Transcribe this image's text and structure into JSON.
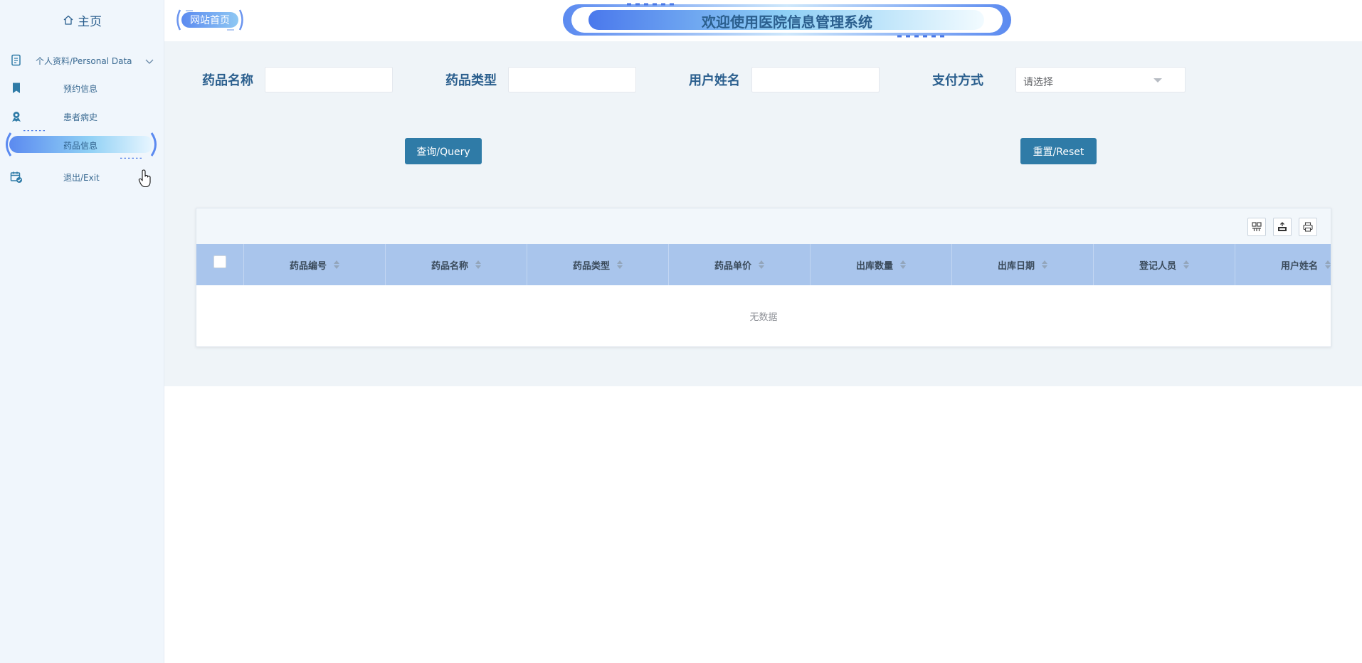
{
  "sidebar": {
    "home_label": "主页",
    "items": [
      {
        "label": "个人资料/Personal Data",
        "icon": "document-icon"
      },
      {
        "label": "预约信息",
        "icon": "bookmark-icon"
      },
      {
        "label": "患者病史",
        "icon": "user-badge-icon"
      },
      {
        "label": "药品信息",
        "icon": "none",
        "active": true
      },
      {
        "label": "退出/Exit",
        "icon": "calendar-check-icon"
      }
    ]
  },
  "header": {
    "home_link": "网站首页",
    "title": "欢迎使用医院信息管理系统"
  },
  "search": {
    "fields": [
      {
        "label": "药品名称",
        "value": "",
        "placeholder": ""
      },
      {
        "label": "药品类型",
        "value": "",
        "placeholder": ""
      },
      {
        "label": "用户姓名",
        "value": "",
        "placeholder": ""
      }
    ],
    "payment": {
      "label": "支付方式",
      "placeholder": "请选择"
    },
    "query_button": "查询/Query",
    "reset_button": "重置/Reset"
  },
  "table": {
    "columns": [
      "药品编号",
      "药品名称",
      "药品类型",
      "药品单价",
      "出库数量",
      "出库日期",
      "登记人员",
      "用户姓名"
    ],
    "empty_text": "无数据",
    "tools": [
      "grid-icon",
      "export-icon",
      "print-icon"
    ]
  },
  "colors": {
    "primary_button": "#2f7ba7",
    "header_row": "#a9c5ec",
    "label_text": "#2b5f8e",
    "sidebar_bg": "#f0f6fc"
  }
}
